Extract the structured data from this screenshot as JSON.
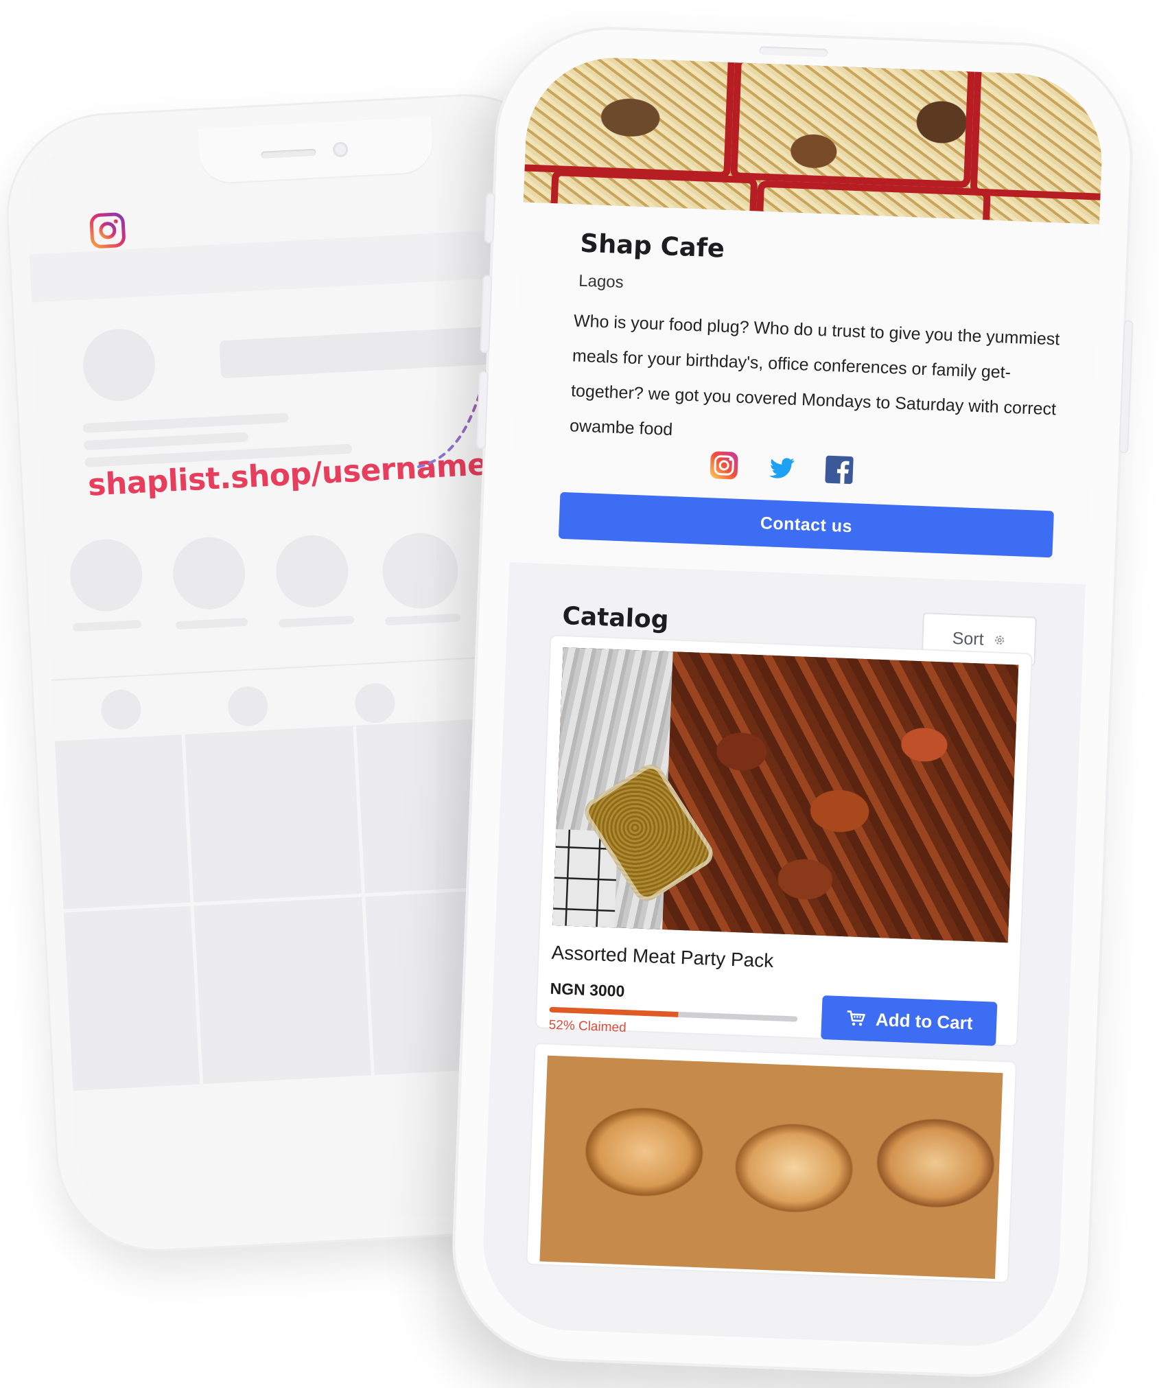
{
  "overlay": {
    "shop_url": "shaplist.shop/username"
  },
  "shop": {
    "name": "Shap Cafe",
    "location": "Lagos",
    "description": "Who is your food plug? Who do u trust to give you the yummiest meals for your birthday's, office conferences or family get-together? we got you covered Mondays to Saturday with correct owambe food",
    "socials": [
      "instagram-icon",
      "twitter-icon",
      "facebook-icon"
    ],
    "contact_label": "Contact us"
  },
  "catalog": {
    "title": "Catalog",
    "sort_label": "Sort",
    "products": [
      {
        "name": "Assorted Meat Party Pack",
        "price": "NGN 3000",
        "claimed_label": "52% Claimed",
        "claimed_fraction": 0.52,
        "add_to_cart_label": "Add to Cart"
      }
    ]
  },
  "colors": {
    "accent": "#3d6df2",
    "brand_red": "#e63e5c",
    "progress": "#e05a24",
    "claimed_text": "#e04a3a"
  }
}
